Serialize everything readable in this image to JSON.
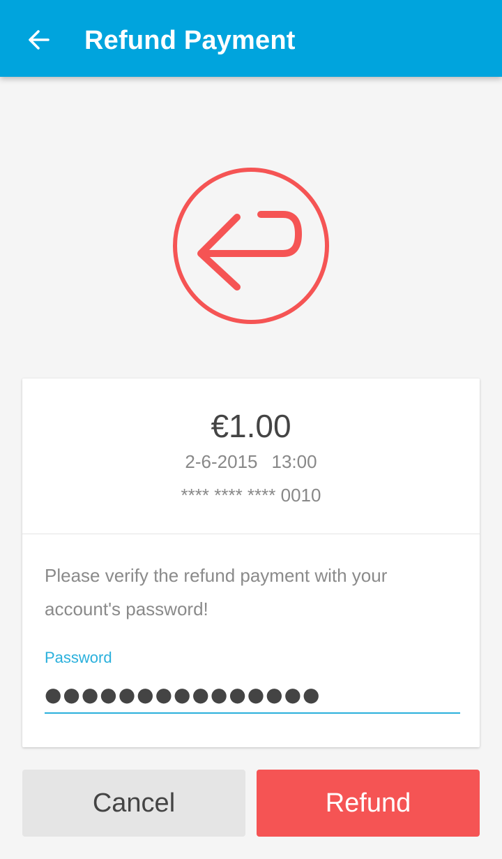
{
  "header": {
    "title": "Refund Payment",
    "back_icon": "arrow-left-icon",
    "color": "#00a4dd"
  },
  "hero": {
    "icon": "refund-return-arrow-icon",
    "color": "#f55454"
  },
  "transaction": {
    "amount": "€1.00",
    "date": "2-6-2015",
    "time": "13:00",
    "card_number": "**** **** **** 0010"
  },
  "verification": {
    "message": "Please verify the refund payment with your account's password!",
    "password_label": "Password",
    "password_value": "●●●●●●●●●●●●●●●",
    "accent_color": "#2ab0dc"
  },
  "actions": {
    "cancel_label": "Cancel",
    "refund_label": "Refund",
    "refund_color": "#f55454"
  }
}
